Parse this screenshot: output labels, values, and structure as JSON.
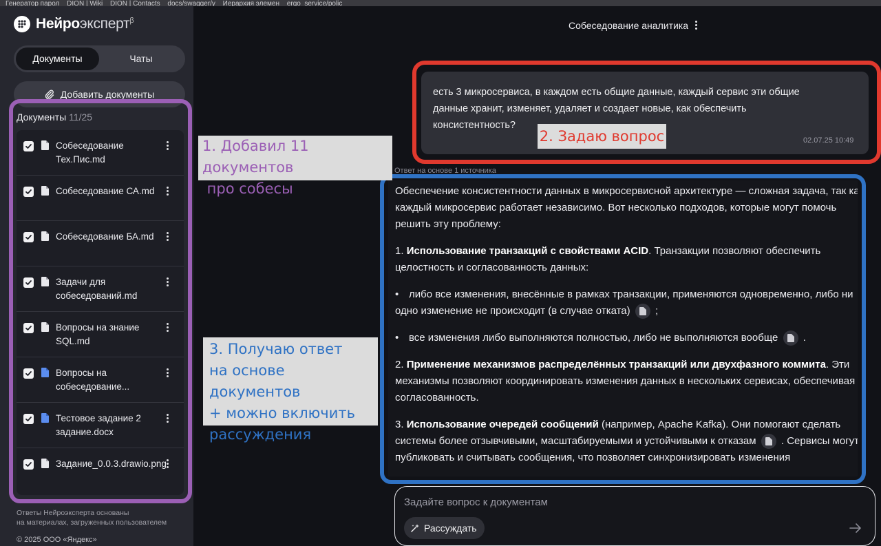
{
  "bookmarks": [
    "Генератор парол",
    "DION | Wiki",
    "DION | Contacts",
    "docs/swagger/y",
    "Иерархия элемен",
    "ergo_service/polic"
  ],
  "app": {
    "logo_main": "Нейро",
    "logo_light": "эксперт",
    "logo_beta": "β"
  },
  "sidebar": {
    "tabs": [
      {
        "label": "Документы",
        "active": true
      },
      {
        "label": "Чаты",
        "active": false
      }
    ],
    "add_button": "Добавить документы",
    "docs_label": "Документы",
    "docs_count": "11/25",
    "documents": [
      {
        "name": "Собеседование Тех.Пис.md",
        "checked": true,
        "icon": "file-icon"
      },
      {
        "name": "Собеседование СА.md",
        "checked": true,
        "icon": "file-icon"
      },
      {
        "name": "Собеседование БА.md",
        "checked": true,
        "icon": "file-icon"
      },
      {
        "name": "Задачи для собеседований.md",
        "checked": true,
        "icon": "file-icon"
      },
      {
        "name": "Вопросы на знание SQL.md",
        "checked": true,
        "icon": "file-icon"
      },
      {
        "name": "Вопросы на собеседование...",
        "checked": true,
        "icon": "docx-file-icon"
      },
      {
        "name": "Тестовое задание 2 задание.docx",
        "checked": true,
        "icon": "docx-file-icon"
      },
      {
        "name": "Задание_0.0.3.drawio.png",
        "checked": true,
        "icon": "file-icon"
      }
    ],
    "footer_line1": "Ответы Нейроэксперта основаны",
    "footer_line2": "на материалах, загруженных пользователем",
    "copyright": "© 2025 ООО «Яндекс»"
  },
  "chat": {
    "title": "Собеседование аналитика",
    "question": "есть 3 микросервиса, в каждом есть общие данные, каждый сервис эти общие данные хранит, изменяет, удаляет и создает новые, как обеспечить консистентность?",
    "question_time": "02.07.25 10:49",
    "source_note": "Ответ на основе 1 источника",
    "answer": {
      "intro": "Обеспечение консистентности данных в микросервисной архитектуре — сложная задача, так как каждый микросервис работает независимо. Вот несколько подходов, которые могут помочь решить эту проблему:",
      "p1_num": "1. ",
      "p1_bold": "Использование транзакций с свойствами ACID",
      "p1_rest": ". Транзакции позволяют обеспечить целостность и согласованность данных:",
      "b1_text": "либо все изменения, внесённые в рамках транзакции, применяются одновременно, либо ни одно изменение не происходит (в случае отката)",
      "b1_end": " ;",
      "b2_text": "все изменения либо выполняются полностью, либо не выполняются вообще",
      "b2_end": " .",
      "p2_num": "2. ",
      "p2_bold": "Применение механизмов распределённых транзакций или двухфазного коммита",
      "p2_rest": ". Эти механизмы позволяют координировать изменения данных в нескольких сервисах, обеспечивая их согласованность.",
      "p3_num": "3. ",
      "p3_bold": "Использование очередей сообщений",
      "p3_rest": " (например, Apache Kafka). Они помогают сделать системы более отзывчивыми, масштабируемыми и устойчивыми к отказам",
      "p3_end": " . Сервисы могут публиковать и считывать сообщения, что позволяет синхронизировать изменения"
    },
    "input_placeholder": "Задайте вопрос к документам",
    "reason_button": "Рассуждать"
  },
  "annotations": {
    "a1_line1": "1. Добавил 11 документов",
    "a1_line2": " про собесы",
    "a2": "2. Задаю вопрос",
    "a3_line1": "3. Получаю ответ",
    "a3_line2": "на основе документов",
    "a3_line3": "+ можно включить",
    "a3_line4": "рассуждения"
  },
  "colors": {
    "purple_frame": "#9b5fb5",
    "red_frame": "#e0392e",
    "blue_frame": "#2f72c4",
    "docx_icon": "#5b8def"
  }
}
